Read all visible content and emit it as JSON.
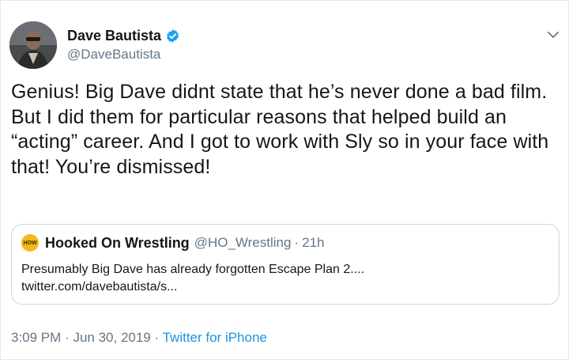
{
  "author": {
    "display_name": "Dave Bautista",
    "handle": "@DaveBautista",
    "verified_icon": "verified-badge-icon",
    "accent_color": "#1da1f2"
  },
  "tweet": {
    "text": "Genius! Big Dave didnt state that he’s never done a bad film. But I did them for particular reasons that helped build an “acting” career. And I got to work with Sly so in your face with that! You’re dismissed!"
  },
  "quoted_tweet": {
    "avatar_text": "HOW",
    "display_name": "Hooked On Wrestling",
    "handle": "@HO_Wrestling",
    "separator": "·",
    "time": "21h",
    "line1": "Presumably Big Dave has already forgotten Escape Plan 2....",
    "line2": "twitter.com/davebautista/s..."
  },
  "meta": {
    "time": "3:09 PM",
    "separator1": "·",
    "date": "Jun 30, 2019",
    "separator2": "·",
    "source": "Twitter for iPhone",
    "source_color": "#1b95e0"
  },
  "menu": {
    "icon": "chevron-down-icon"
  }
}
